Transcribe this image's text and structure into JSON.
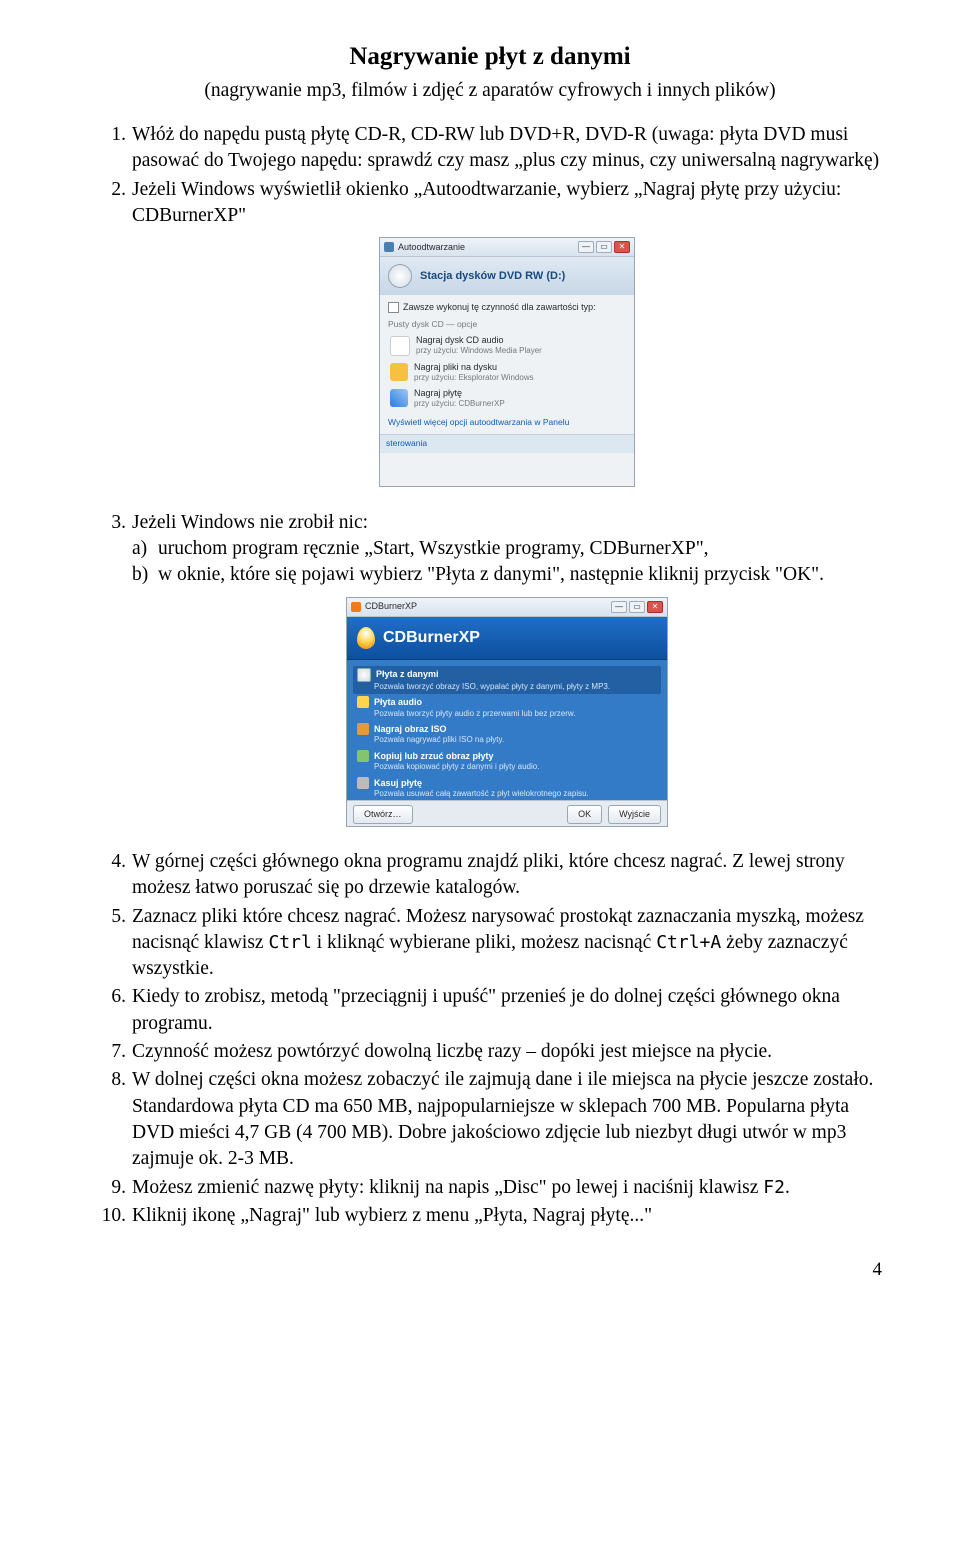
{
  "title": "Nagrywanie płyt z danymi",
  "subtitle": "(nagrywanie mp3, filmów i zdjęć z aparatów cyfrowych i innych plików)",
  "steps": {
    "s1": "Włóż do napędu pustą płytę CD-R, CD-RW lub DVD+R, DVD-R (uwaga: płyta DVD musi pasować do Twojego napędu: sprawdź czy masz „plus czy minus, czy uniwersalną nagrywarkę)",
    "s2": "Jeżeli Windows wyświetlił okienko „Autoodtwarzanie, wybierz „Nagraj płytę przy użyciu: CDBurnerXP\"",
    "s3": "Jeżeli Windows nie zrobił nic:",
    "s3a": "uruchom program ręcznie „Start, Wszystkie programy, CDBurnerXP\",",
    "s3b": "w oknie, które się pojawi wybierz \"Płyta z danymi\", następnie kliknij przycisk \"OK\".",
    "s4": "W górnej części głównego okna programu znajdź pliki, które chcesz nagrać. Z lewej strony możesz łatwo poruszać się po drzewie katalogów.",
    "s5a": "Zaznacz pliki które chcesz nagrać. Możesz narysować prostokąt zaznaczania myszką, możesz nacisnąć klawisz ",
    "s5b": " i kliknąć wybierane pliki, możesz nacisnąć ",
    "s5c": " żeby zaznaczyć wszystkie.",
    "s6": "Kiedy to zrobisz, metodą \"przeciągnij i upuść\" przenieś je do dolnej części głównego okna programu.",
    "s7": "Czynność możesz powtórzyć dowolną liczbę razy – dopóki jest miejsce na płycie.",
    "s8": "W dolnej części okna możesz zobaczyć ile zajmują dane i ile miejsca na płycie jeszcze zostało. Standardowa płyta CD ma 650 MB, najpopularniejsze w sklepach 700 MB. Popularna płyta DVD mieści 4,7 GB (4 700 MB). Dobre jakościowo zdjęcie lub niezbyt długi utwór w mp3 zajmuje ok. 2-3 MB.",
    "s9a": "Możesz zmienić nazwę płyty: kliknij na napis „Disc\" po lewej i naciśnij klawisz ",
    "s9b": ".",
    "s10": "Kliknij ikonę „Nagraj\" lub wybierz z menu „Płyta, Nagraj płytę...\""
  },
  "keys": {
    "ctrl": "Ctrl",
    "ctrlA": "Ctrl+A",
    "f2": "F2"
  },
  "dlg_auto": {
    "title": "Autoodtwarzanie",
    "drive": "Stacja dysków DVD RW (D:)",
    "always": "Zawsze wykonuj tę czynność dla zawartości typ:",
    "grp": "Pusty dysk CD — opcje",
    "o1a": "Nagraj dysk CD audio",
    "o1b": "przy użyciu: Windows Media Player",
    "o2a": "Nagraj pliki na dysku",
    "o2b": "przy użyciu: Eksplorator Windows",
    "o3a": "Nagraj płytę",
    "o3b": "przy użyciu: CDBurnerXP",
    "link": "Wyświetl więcej opcji autoodtwarzania w Panelu",
    "foot": "sterowania"
  },
  "dlg_cdb": {
    "title": "CDBurnerXP",
    "i1t": "Płyta z danymi",
    "i1s": "Pozwala tworzyć obrazy ISO, wypalać płyty z danymi, płyty z MP3.",
    "i2t": "Płyta audio",
    "i2s": "Pozwala tworzyć płyty audio z przerwami lub bez przerw.",
    "i3t": "Nagraj obraz ISO",
    "i3s": "Pozwala nagrywać pliki ISO na płyty.",
    "i4t": "Kopiuj lub zrzuć obraz płyty",
    "i4s": "Pozwala kopiować płyty z danymi i płyty audio.",
    "i5t": "Kasuj płytę",
    "i5s": "Pozwala usuwać całą zawartość z płyt wielokrotnego zapisu.",
    "open": "Otwórz…",
    "ok": "OK",
    "close": "Wyjście"
  },
  "pagenum": "4"
}
